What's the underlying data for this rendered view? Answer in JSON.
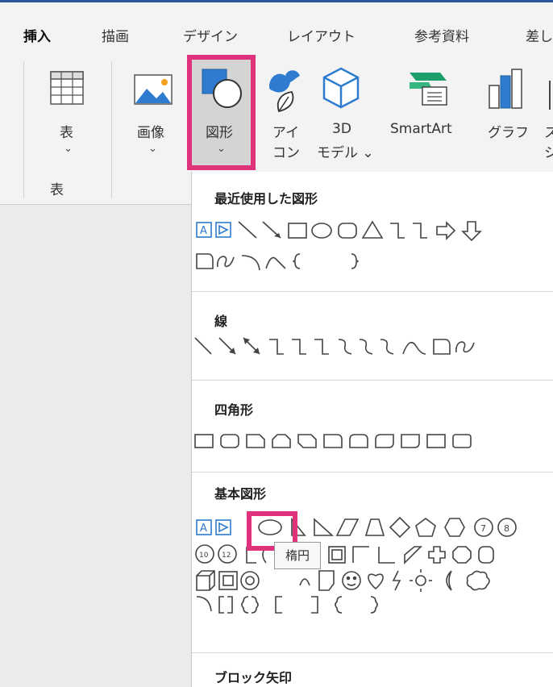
{
  "tabs": [
    {
      "label": "挿入",
      "active": true
    },
    {
      "label": "描画"
    },
    {
      "label": "デザイン"
    },
    {
      "label": "レイアウト"
    },
    {
      "label": "参考資料"
    },
    {
      "label": "差し"
    }
  ],
  "ribbon": {
    "table": {
      "label": "表",
      "chevron": "⌄",
      "group_label": "表"
    },
    "image": {
      "label": "画像",
      "chevron": "⌄"
    },
    "shapes": {
      "label": "図形",
      "chevron": "⌄"
    },
    "icons": {
      "line1": "アイ",
      "line2": "コン"
    },
    "model3d": {
      "line1": "3D",
      "line2": "モデル ⌄"
    },
    "smartart": {
      "label": "SmartArt"
    },
    "chart": {
      "label": "グラフ"
    },
    "screenshot": {
      "line1": "ス",
      "line2": "シ"
    }
  },
  "panel": {
    "sections": [
      {
        "title": "最近使用した図形"
      },
      {
        "title": "線"
      },
      {
        "title": "四角形"
      },
      {
        "title": "基本図形"
      },
      {
        "title": "ブロック矢印"
      }
    ],
    "tooltip": "楕円"
  },
  "colors": {
    "accent": "#2b579a",
    "highlight": "#e0317d",
    "icon_blue": "#2e7bcf"
  }
}
